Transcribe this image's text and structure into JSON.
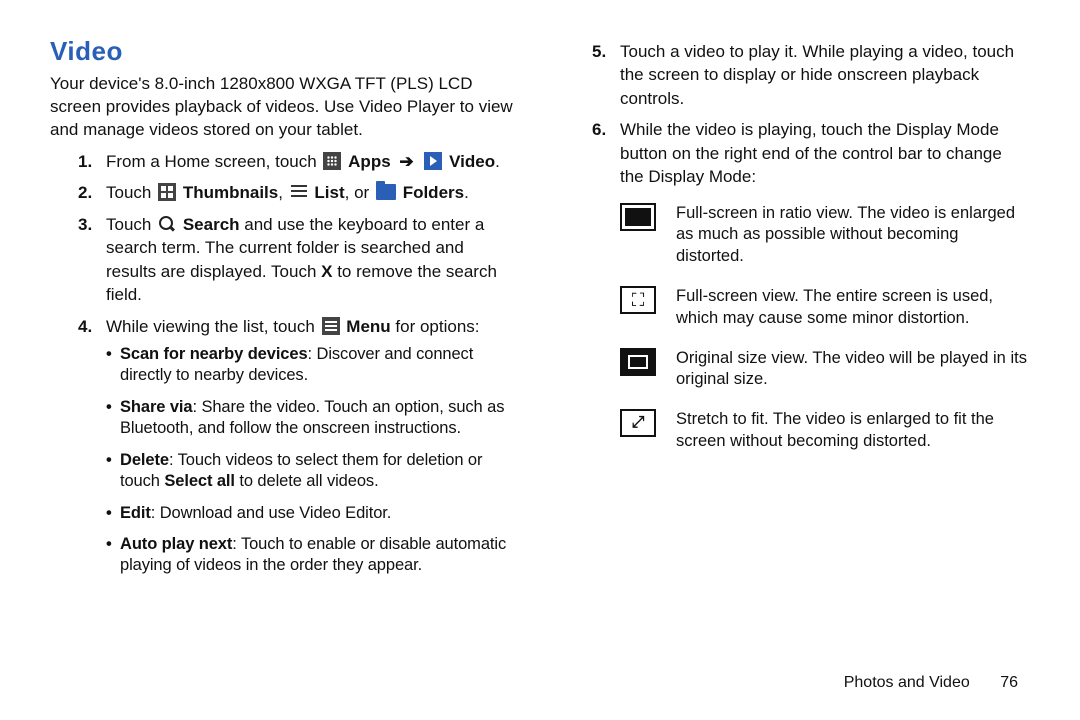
{
  "title": "Video",
  "intro": "Your device's 8.0-inch 1280x800 WXGA TFT (PLS) LCD screen provides playback of videos. Use Video Player to view and manage videos stored on your tablet.",
  "steps_left": {
    "s1_a": "From a Home screen, touch ",
    "s1_apps": "Apps",
    "s1_video": "Video",
    "s1_end": ".",
    "s2_a": "Touch ",
    "s2_thumb": "Thumbnails",
    "s2_list": "List",
    "s2_or": ", or ",
    "s2_folders": "Folders",
    "s2_end": ".",
    "s3_a": "Touch ",
    "s3_search": "Search",
    "s3_b": " and use the keyboard to enter a search term. The current folder is searched and results are displayed. Touch ",
    "s3_x": "X",
    "s3_c": " to remove the search field.",
    "s4_a": "While viewing the list, touch ",
    "s4_menu": "Menu",
    "s4_b": " for options:",
    "sub": {
      "scan_b": "Scan for nearby devices",
      "scan_t": ": Discover and connect directly to nearby devices.",
      "share_b": "Share via",
      "share_t": ": Share the video. Touch an option, such as Bluetooth, and follow the onscreen instructions.",
      "del_b": "Delete",
      "del_t1": ": Touch videos to select them for deletion or touch ",
      "del_sel": "Select all",
      "del_t2": " to delete all videos.",
      "edit_b": "Edit",
      "edit_t": ": Download and use Video Editor.",
      "auto_b": "Auto play next",
      "auto_t": ": Touch to enable or disable automatic playing of videos in the order they appear."
    }
  },
  "steps_right": {
    "s5": "Touch a video to play it. While playing a video, touch the screen to display or hide onscreen playback controls.",
    "s6": "While the video is playing, touch the Display Mode button on the right end of the control bar to change the Display Mode:",
    "modes": {
      "ratio": "Full-screen in ratio view. The video is enlarged as much as possible without becoming distorted.",
      "full": "Full-screen view. The entire screen is used, which may cause some minor distortion.",
      "orig": "Original size view. The video will be played in its original size.",
      "stretch": "Stretch to fit. The video is enlarged to fit the screen without becoming distorted."
    }
  },
  "footer": {
    "section": "Photos and Video",
    "page": "76"
  }
}
